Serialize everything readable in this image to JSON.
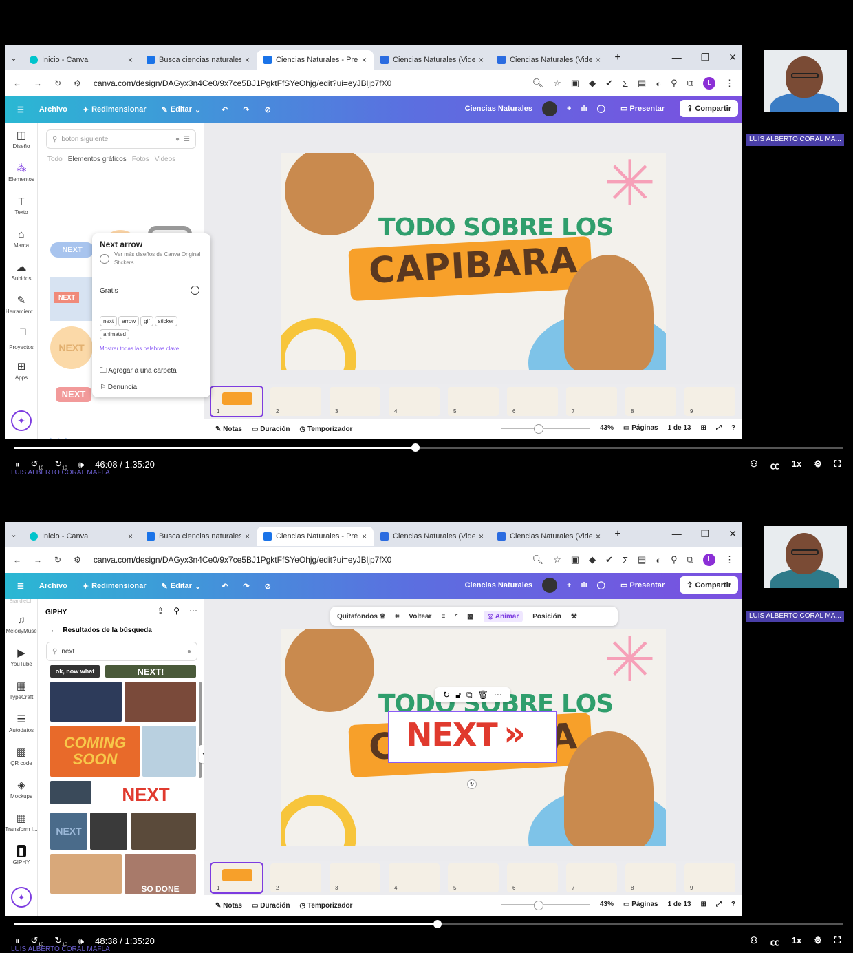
{
  "browser": {
    "tabs": [
      {
        "label": "Inicio - Canva"
      },
      {
        "label": "Busca ciencias naturales"
      },
      {
        "label": "Ciencias Naturales - Pres"
      },
      {
        "label": "Ciencias Naturales (Vide"
      },
      {
        "label": "Ciencias Naturales (Vide"
      }
    ],
    "url": "canva.com/design/DAGyx3n4Ce0/9x7ce5BJ1PgktFfSYeOhjg/edit?ui=eyJBljp7fX0",
    "profile_initial": "L"
  },
  "canva": {
    "menu": {
      "file": "Archivo",
      "resize": "Redimensionar",
      "edit": "Editar"
    },
    "project_name": "Ciencias Naturales",
    "present": "Presentar",
    "share": "Compartir",
    "rail1": [
      "Diseño",
      "Elementos",
      "Texto",
      "Marca",
      "Subidos",
      "Herramient...",
      "Proyectos",
      "Apps"
    ],
    "rail2": [
      "MelodyMuse",
      "YouTube",
      "TypeCraft",
      "Autodatos",
      "QR code",
      "Mockups",
      "Transform I...",
      "GIPHY"
    ],
    "rail2_top": "Brandfetch",
    "slide": {
      "line1": "TODO SOBRE LOS",
      "line2": "CAPIBARA"
    },
    "status": {
      "notes": "Notas",
      "duration": "Duración",
      "timer": "Temporizador",
      "zoom": "43%",
      "pages": "Páginas",
      "page_of": "1 de 13"
    },
    "thumbs": [
      "1",
      "2",
      "3",
      "4",
      "5",
      "6",
      "7",
      "8",
      "9"
    ]
  },
  "panel1": {
    "search_placeholder": "boton siguiente",
    "categories": [
      "Todo",
      "Elementos gráficos",
      "Fotos",
      "Videos"
    ],
    "sticker_labels": {
      "next_pill": "NEXT",
      "next_small": "NEXT",
      "next_coin": "NEXT",
      "next_red": "NEXT"
    },
    "popover": {
      "title": "Next arrow",
      "by": "Ver más diseños de Canva Original Stickers",
      "price": "Gratis",
      "tags": [
        "next",
        "arrow",
        "gif",
        "sticker",
        "animated"
      ],
      "show_keywords": "Mostrar todas las palabras clave",
      "add_folder": "Agregar a una carpeta",
      "report": "Denuncia"
    },
    "time": "46:08 / 1:35:20",
    "progress": 0.484
  },
  "panel2": {
    "app_title": "GIPHY",
    "results_title": "Resultados de la búsqueda",
    "search_value": "next",
    "gifs": [
      "ok, now what",
      "NEXT!",
      "COMING SOON",
      "NEXT",
      "NEXT",
      "SO DONE"
    ],
    "context_bar": {
      "remove_bg": "Quitafondos",
      "flip": "Voltear",
      "animate": "Animar",
      "position": "Posición"
    },
    "selected_text": "NEXT",
    "time": "48:38 / 1:35:20",
    "progress": 0.511
  },
  "video": {
    "presenter": "LUIS ALBERTO CORAL MA...",
    "watermark": "LUIS ALBERTO CORAL MAFLA",
    "speed": "1x",
    "skip_back": "10",
    "skip_fwd": "10"
  }
}
